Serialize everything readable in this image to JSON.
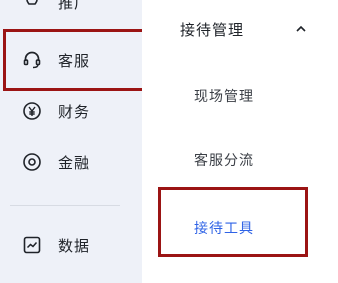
{
  "sidebar": {
    "items": [
      {
        "label": "推广",
        "icon": "lightbulb-icon"
      },
      {
        "label": "客服",
        "icon": "headset-icon"
      },
      {
        "label": "财务",
        "icon": "yen-icon"
      },
      {
        "label": "金融",
        "icon": "coin-icon"
      },
      {
        "label": "数据",
        "icon": "chart-icon"
      }
    ]
  },
  "panel": {
    "group_title": "接待管理",
    "sub_items": [
      {
        "label": "现场管理"
      },
      {
        "label": "客服分流"
      },
      {
        "label": "接待工具",
        "active": true
      }
    ]
  },
  "colors": {
    "sidebar_bg": "#eef1f8",
    "active_text": "#2f63e6",
    "highlight_border": "#9b1414"
  }
}
